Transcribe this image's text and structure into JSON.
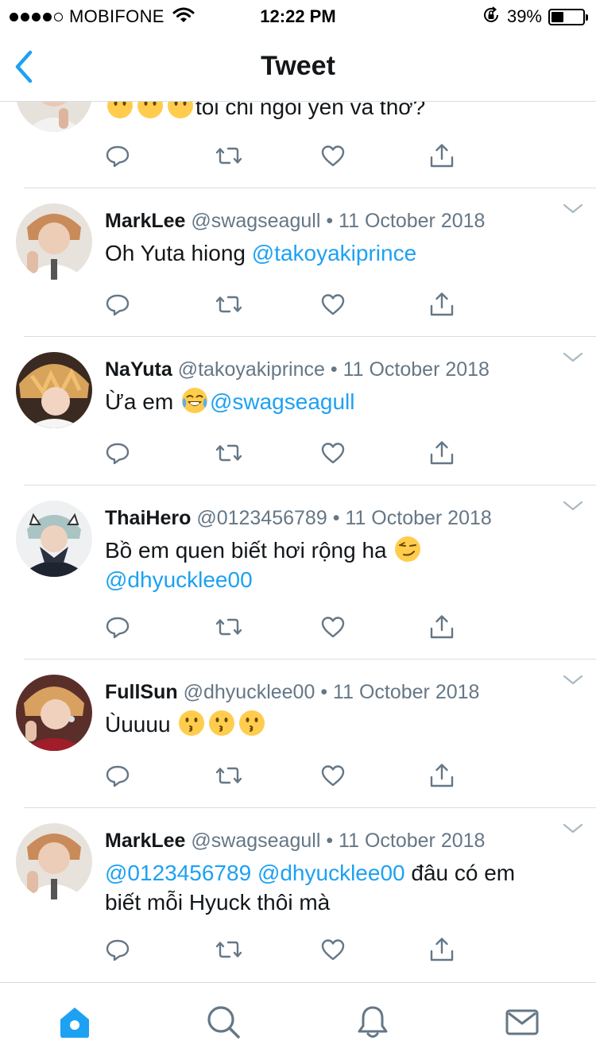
{
  "status_bar": {
    "carrier": "MOBIFONE",
    "time": "12:22 PM",
    "battery_percent": "39%",
    "battery_level": 0.39,
    "signal_bars_filled": 4,
    "signal_bars_total": 5
  },
  "nav": {
    "title": "Tweet",
    "back_icon": "chevron-left-icon"
  },
  "colors": {
    "accent": "#1da1f2",
    "text": "#14171a",
    "secondary": "#657786",
    "divider": "#d8dde1",
    "active_tab": "#1da1f2"
  },
  "partial_tweet": {
    "text": "tôi chỉ ngồi yên và thở?",
    "emoji_count": 3
  },
  "tweets": [
    {
      "name": "MarkLee",
      "handle": "@swagseagull",
      "separator": "•",
      "date": "11 October 2018",
      "body_prefix": "Oh Yuta hiong ",
      "mention_1": "@takoyakiprince"
    },
    {
      "name": "NaYuta",
      "handle": "@takoyakiprince",
      "separator": "•",
      "date": "11 October 2018",
      "body_prefix": "Ừa em ",
      "mention_1": "@swagseagull"
    },
    {
      "name": "ThaiHero",
      "handle": "@0123456789",
      "separator": "•",
      "date": "11 October 2018",
      "body_prefix": "Bồ em quen biết hơi rộng ha ",
      "mention_1": "@dhyucklee00"
    },
    {
      "name": "FullSun",
      "handle": "@dhyucklee00",
      "separator": "•",
      "date": "11 October 2018",
      "body_prefix": "Ùuuuu "
    },
    {
      "name": "MarkLee",
      "handle": "@swagseagull",
      "separator": "•",
      "date": "11 October 2018",
      "mention_1": "@0123456789",
      "mention_2": "@dhyucklee00",
      "body_suffix": " đâu có em biết mỗi Hyuck thôi mà"
    }
  ],
  "tweet_actions": [
    "reply-icon",
    "retweet-icon",
    "like-icon",
    "share-icon"
  ],
  "tab_bar": [
    {
      "name": "home-icon",
      "active": true
    },
    {
      "name": "search-icon",
      "active": false
    },
    {
      "name": "notifications-icon",
      "active": false
    },
    {
      "name": "messages-icon",
      "active": false
    }
  ]
}
